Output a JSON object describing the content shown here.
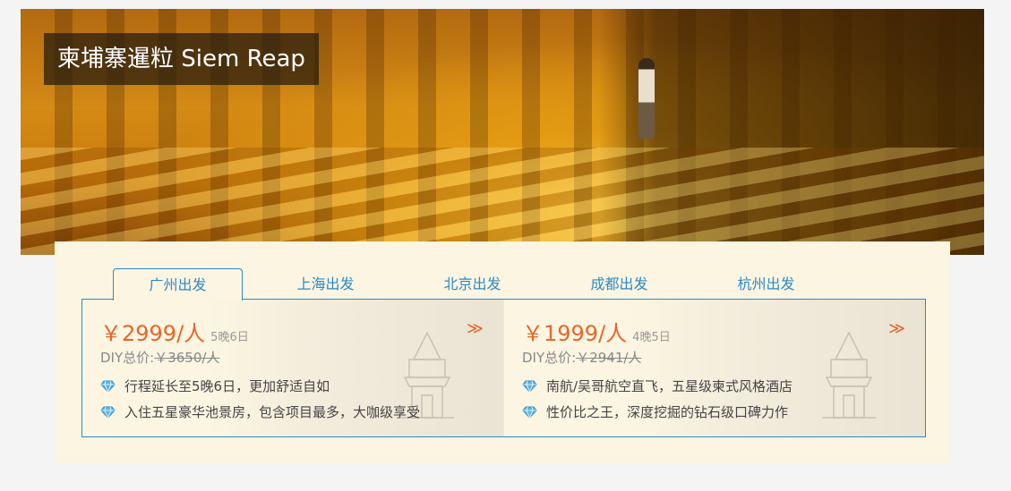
{
  "hero": {
    "title": "柬埔寨暹粒 Siem Reap"
  },
  "tabs": [
    {
      "label": "广州出发",
      "active": true
    },
    {
      "label": "上海出发",
      "active": false
    },
    {
      "label": "北京出发",
      "active": false
    },
    {
      "label": "成都出发",
      "active": false
    },
    {
      "label": "杭州出发",
      "active": false
    }
  ],
  "cards": [
    {
      "price": "￥2999/人",
      "nights": "5晚6日",
      "diy_label": "DIY总价:",
      "diy_price": "￥3650/人",
      "arrow_icon": "double-chevron-right-icon",
      "features": [
        "行程延长至5晚6日，更加舒适自如",
        "入住五星豪华池景房，包含项目最多，大咖级享受"
      ]
    },
    {
      "price": "￥1999/人",
      "nights": "4晚5日",
      "diy_label": "DIY总价:",
      "diy_price": "￥2941/人",
      "arrow_icon": "double-chevron-right-icon",
      "features": [
        "南航/吴哥航空直飞，五星级柬式风格酒店",
        "性价比之王，深度挖掘的钻石级口碑力作"
      ]
    }
  ],
  "feature_icon": "diamond-icon",
  "colors": {
    "accent_blue": "#2c8ac7",
    "price_orange": "#e8662b",
    "panel_bg": "#fbf5e1"
  }
}
